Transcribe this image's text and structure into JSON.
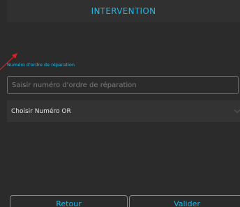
{
  "header": {
    "title": "INTERVENTION"
  },
  "form": {
    "field_label": "Numéro d'ordre de réparation",
    "input_placeholder": "Saisir numéro d'ordre de réparation",
    "input_value": "",
    "select_label": "Choisir Numéro OR"
  },
  "actions": {
    "back_label": "Retour",
    "validate_label": "Valider"
  },
  "icons": {
    "annotation_arrow": "red-arrow-icon",
    "select_chevron": "chevron-down-icon"
  },
  "colors": {
    "accent": "#1fb8e6",
    "background": "#2b2b2b",
    "annotation": "#d92323"
  }
}
